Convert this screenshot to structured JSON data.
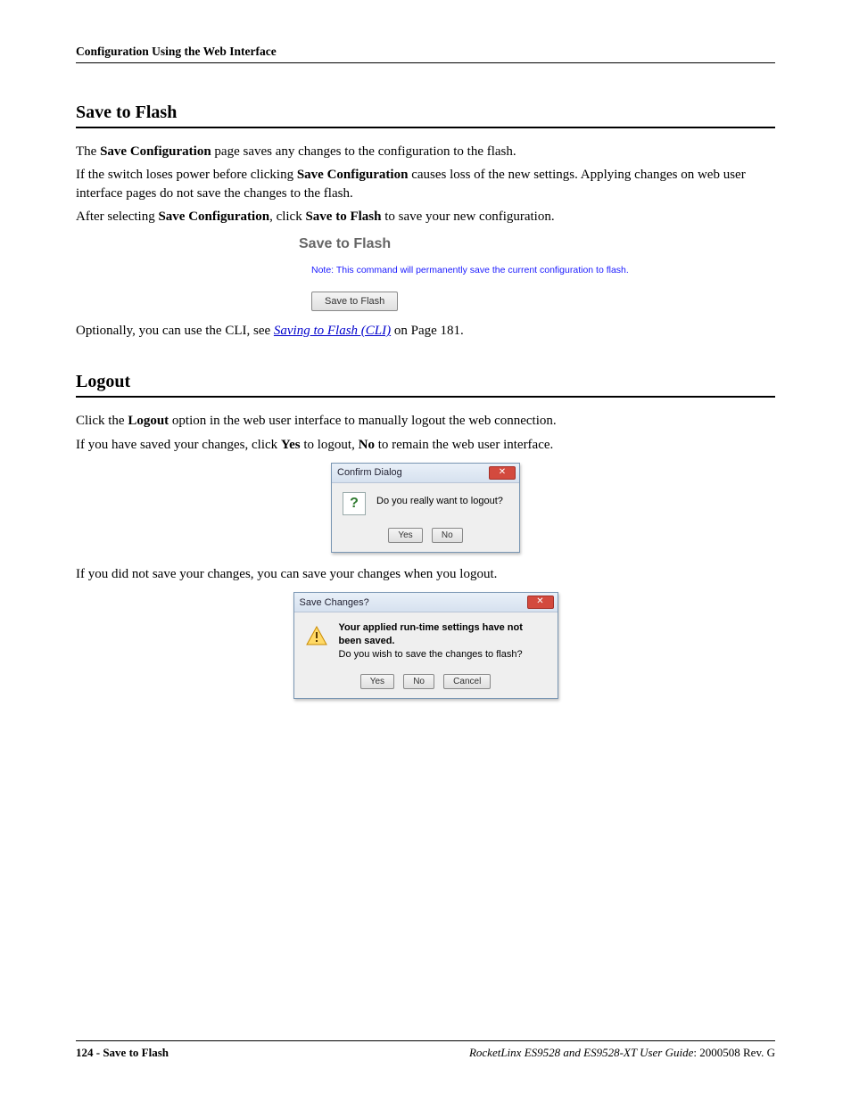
{
  "running_header": "Configuration Using the Web Interface",
  "section1": {
    "title": "Save to Flash",
    "p1_a": "The ",
    "p1_b": "Save Configuration",
    "p1_c": " page saves any changes to the configuration to the flash.",
    "p2_a": "If the switch loses power before clicking ",
    "p2_b": "Save Configuration",
    "p2_c": " causes loss of the new settings. Applying changes on web user interface pages do not save the changes to the flash.",
    "p3_a": "After selecting ",
    "p3_b": "Save Configuration",
    "p3_c": ", click ",
    "p3_d": "Save to Flash",
    "p3_e": " to save your new configuration.",
    "ui_title": "Save to Flash",
    "ui_note": "Note: This command will permanently save the current configuration to flash.",
    "ui_button": "Save to Flash",
    "p4_a": "Optionally, you can use the CLI, see ",
    "p4_link": "Saving to Flash (CLI)",
    "p4_b": " on Page 181."
  },
  "section2": {
    "title": "Logout",
    "p1_a": "Click the ",
    "p1_b": "Logout",
    "p1_c": " option in the web user interface to manually logout the web connection.",
    "p2_a": "If you have saved your changes, click ",
    "p2_b": "Yes",
    "p2_c": " to logout, ",
    "p2_d": "No",
    "p2_e": " to remain the web user interface.",
    "dialog1": {
      "title": "Confirm Dialog",
      "msg": "Do you really want to logout?",
      "yes": "Yes",
      "no": "No"
    },
    "p3": "If you did not save your changes, you can save your changes when you logout.",
    "dialog2": {
      "title": "Save Changes?",
      "msg_bold": "Your applied run-time settings have not been saved.",
      "msg_line2": "Do you wish to save the changes to flash?",
      "yes": "Yes",
      "no": "No",
      "cancel": "Cancel"
    }
  },
  "footer": {
    "left": "124 - Save to Flash",
    "right_italic": "RocketLinx ES9528 and ES9528-XT User Guide",
    "right_tail": ": 2000508 Rev. G"
  }
}
